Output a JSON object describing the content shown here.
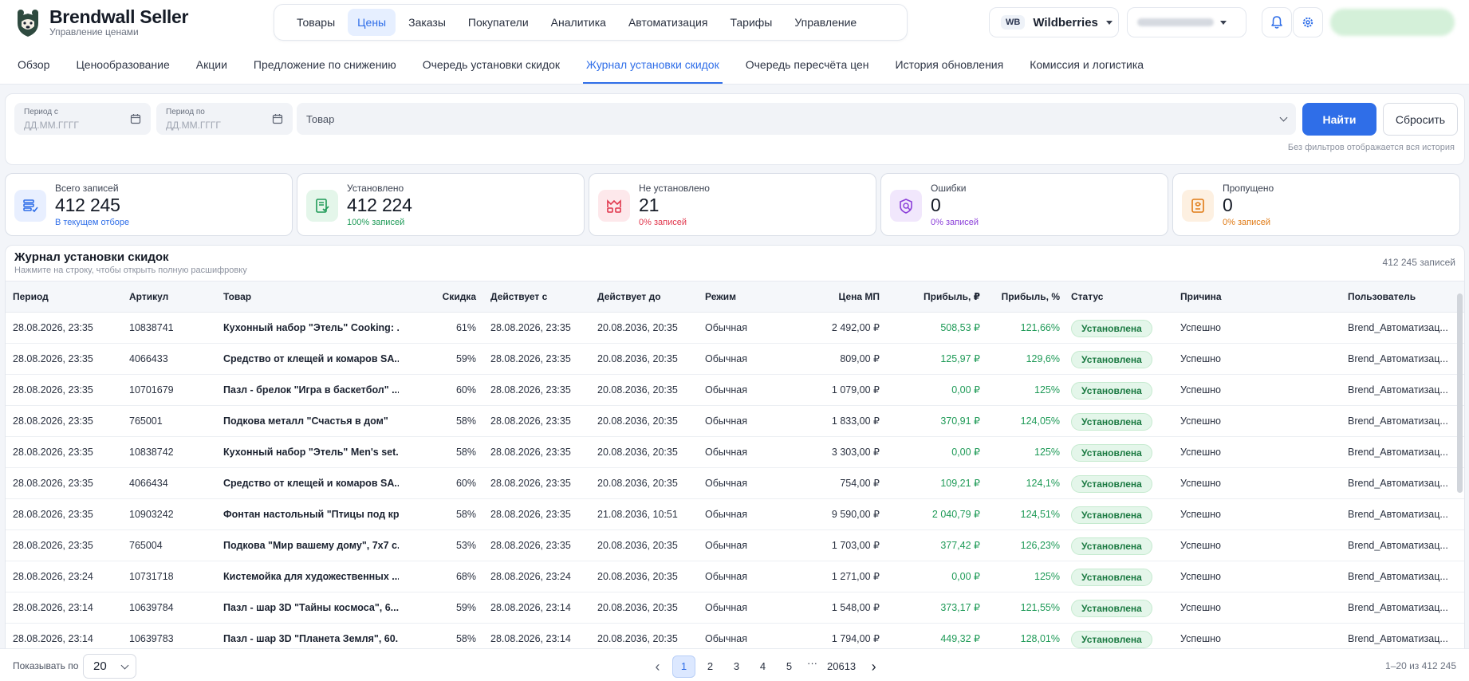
{
  "brand": {
    "title": "Brendwall Seller",
    "subtitle": "Управление ценами"
  },
  "mainnav": [
    "Товары",
    "Цены",
    "Заказы",
    "Покупатели",
    "Аналитика",
    "Автоматизация",
    "Тарифы",
    "Управление"
  ],
  "mainnav_active": "Цены",
  "marketplace": {
    "badge": "WB",
    "name": "Wildberries"
  },
  "subnav": [
    "Обзор",
    "Ценообразование",
    "Акции",
    "Предложение по снижению",
    "Очередь установки скидок",
    "Журнал установки скидок",
    "Очередь пересчёта цен",
    "История обновления",
    "Комиссия и логистика"
  ],
  "subnav_active": "Журнал установки скидок",
  "filters": {
    "date_from_label": "Период с",
    "date_to_label": "Период по",
    "date_placeholder": "ДД.ММ.ГГГГ",
    "product_placeholder": "Товар",
    "find_label": "Найти",
    "reset_label": "Сбросить",
    "hint": "Без фильтров отображается вся история"
  },
  "stats": [
    {
      "label": "Всего записей",
      "value": "412 245",
      "sub": "В текущем отборе",
      "color": "#2f6ee8",
      "bg": "#e8efff",
      "icon": "records-icon"
    },
    {
      "label": "Установлено",
      "value": "412 224",
      "sub": "100% записей",
      "color": "#1e9a57",
      "bg": "#e4f6ea",
      "icon": "installed-icon"
    },
    {
      "label": "Не установлено",
      "value": "21",
      "sub": "0% записей",
      "color": "#e0364c",
      "bg": "#fde8eb",
      "icon": "not-installed-icon"
    },
    {
      "label": "Ошибки",
      "value": "0",
      "sub": "0% записей",
      "color": "#8b3fd9",
      "bg": "#f1e7fc",
      "icon": "errors-icon"
    },
    {
      "label": "Пропущено",
      "value": "0",
      "sub": "0% записей",
      "color": "#e07b16",
      "bg": "#fdf0e1",
      "icon": "skipped-icon"
    }
  ],
  "table": {
    "title": "Журнал установки скидок",
    "subtitle": "Нажмите на строку, чтобы открыть полную расшифровку",
    "count": "412 245 записей",
    "columns": [
      "Период",
      "Артикул",
      "Товар",
      "Скидка",
      "Действует с",
      "Действует до",
      "Режим",
      "Цена МП",
      "Прибыль, ₽",
      "Прибыль, %",
      "Статус",
      "Причина",
      "Пользователь"
    ],
    "rows": [
      [
        "28.08.2026, 23:35",
        "10838741",
        "Кухонный набор \"Этель\" Cooking: ...",
        "61%",
        "28.08.2026, 23:35",
        "20.08.2036, 20:35",
        "Обычная",
        "2 492,00 ₽",
        "508,53 ₽",
        "121,66%",
        "Установлена",
        "Успешно",
        "Brend_Автоматизац..."
      ],
      [
        "28.08.2026, 23:35",
        "4066433",
        "Средство от клещей и комаров SA...",
        "59%",
        "28.08.2026, 23:35",
        "20.08.2036, 20:35",
        "Обычная",
        "809,00 ₽",
        "125,97 ₽",
        "129,6%",
        "Установлена",
        "Успешно",
        "Brend_Автоматизац..."
      ],
      [
        "28.08.2026, 23:35",
        "10701679",
        "Пазл - брелок \"Игра в баскетбол\" ...",
        "60%",
        "28.08.2026, 23:35",
        "20.08.2036, 20:35",
        "Обычная",
        "1 079,00 ₽",
        "0,00 ₽",
        "125%",
        "Установлена",
        "Успешно",
        "Brend_Автоматизац..."
      ],
      [
        "28.08.2026, 23:35",
        "765001",
        "Подкова металл \"Счастья в дом\"",
        "58%",
        "28.08.2026, 23:35",
        "20.08.2036, 20:35",
        "Обычная",
        "1 833,00 ₽",
        "370,91 ₽",
        "124,05%",
        "Установлена",
        "Успешно",
        "Brend_Автоматизац..."
      ],
      [
        "28.08.2026, 23:35",
        "10838742",
        "Кухонный набор \"Этель\" Men's set...",
        "58%",
        "28.08.2026, 23:35",
        "20.08.2036, 20:35",
        "Обычная",
        "3 303,00 ₽",
        "0,00 ₽",
        "125%",
        "Установлена",
        "Успешно",
        "Brend_Автоматизац..."
      ],
      [
        "28.08.2026, 23:35",
        "4066434",
        "Средство от клещей и комаров SA...",
        "60%",
        "28.08.2026, 23:35",
        "20.08.2036, 20:35",
        "Обычная",
        "754,00 ₽",
        "109,21 ₽",
        "124,1%",
        "Установлена",
        "Успешно",
        "Brend_Автоматизац..."
      ],
      [
        "28.08.2026, 23:35",
        "10903242",
        "Фонтан настольный \"Птицы под кр...",
        "58%",
        "28.08.2026, 23:35",
        "21.08.2036, 10:51",
        "Обычная",
        "9 590,00 ₽",
        "2 040,79 ₽",
        "124,51%",
        "Установлена",
        "Успешно",
        "Brend_Автоматизац..."
      ],
      [
        "28.08.2026, 23:35",
        "765004",
        "Подкова \"Мир вашему дому\", 7x7 с...",
        "53%",
        "28.08.2026, 23:35",
        "20.08.2036, 20:35",
        "Обычная",
        "1 703,00 ₽",
        "377,42 ₽",
        "126,23%",
        "Установлена",
        "Успешно",
        "Brend_Автоматизац..."
      ],
      [
        "28.08.2026, 23:24",
        "10731718",
        "Кистемойка для художественных ...",
        "68%",
        "28.08.2026, 23:24",
        "20.08.2036, 20:35",
        "Обычная",
        "1 271,00 ₽",
        "0,00 ₽",
        "125%",
        "Установлена",
        "Успешно",
        "Brend_Автоматизац..."
      ],
      [
        "28.08.2026, 23:14",
        "10639784",
        "Пазл - шар 3D \"Тайны космоса\", 6...",
        "59%",
        "28.08.2026, 23:14",
        "20.08.2036, 20:35",
        "Обычная",
        "1 548,00 ₽",
        "373,17 ₽",
        "121,55%",
        "Установлена",
        "Успешно",
        "Brend_Автоматизац..."
      ],
      [
        "28.08.2026, 23:14",
        "10639783",
        "Пазл - шар 3D \"Планета Земля\", 60...",
        "58%",
        "28.08.2026, 23:14",
        "20.08.2036, 20:35",
        "Обычная",
        "1 794,00 ₽",
        "449,32 ₽",
        "128,01%",
        "Установлена",
        "Успешно",
        "Brend_Автоматизац..."
      ]
    ]
  },
  "pagination": {
    "per_page_label": "Показывать по",
    "per_page": "20",
    "pages": [
      "1",
      "2",
      "3",
      "4",
      "5",
      "···",
      "20613"
    ],
    "current": "1",
    "range": "1–20 из 412 245"
  }
}
